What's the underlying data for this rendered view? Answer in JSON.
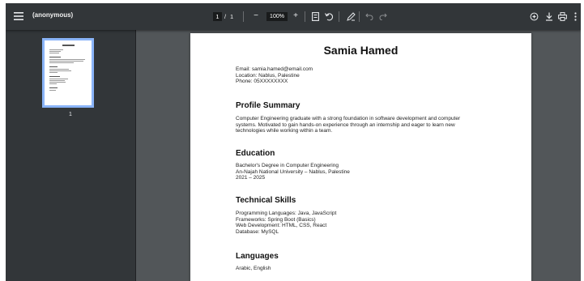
{
  "toolbar": {
    "title": "(anonymous)",
    "page_current": "1",
    "page_separator": "/",
    "page_total": "1",
    "zoom_level": "100%",
    "zoom_out_label": "−",
    "zoom_in_label": "+"
  },
  "sidebar": {
    "thumbnails": [
      {
        "page_label": "1",
        "selected": true
      }
    ]
  },
  "document": {
    "name": "Samia Hamed",
    "contact": {
      "email": "Email: samia.hamed@email.com",
      "location": "Location: Nablus, Palestine",
      "phone": "Phone: 05XXXXXXXX"
    },
    "profile": {
      "heading": "Profile Summary",
      "lines": [
        "Computer Engineering graduate with a strong foundation in software development and computer",
        "systems. Motivated to gain hands-on experience through an internship and eager to learn new",
        "technologies while working within a team."
      ]
    },
    "education": {
      "heading": "Education",
      "degree": "Bachelor's Degree in Computer Engineering",
      "university": "An-Najah National University – Nablus, Palestine",
      "years": "2021 – 2025"
    },
    "skills": {
      "heading": "Technical Skills",
      "items": [
        "Programming Languages: Java, JavaScript",
        "Frameworks: Spring Boot (Basics)",
        "Web Development: HTML, CSS, React",
        "Database: MySQL"
      ]
    },
    "languages": {
      "heading": "Languages",
      "text": "Arabic, English"
    }
  },
  "colors": {
    "toolbar_bg": "#323639",
    "viewer_bg": "#525659",
    "thumbnail_selected": "#8ab4f8"
  }
}
